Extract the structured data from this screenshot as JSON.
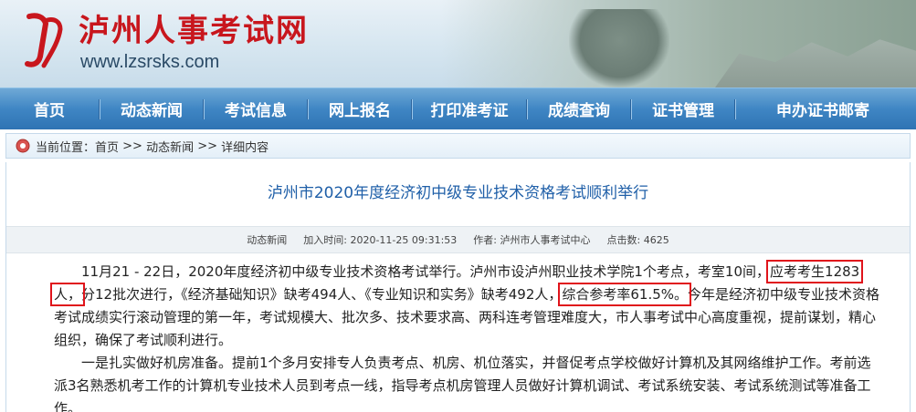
{
  "header": {
    "site_title": "泸州人事考试网",
    "site_url": "www.lzsrsks.com",
    "logo_icon": "lz-logo-icon",
    "brand_color": "#c8161d"
  },
  "nav": {
    "items": [
      {
        "label": "首页"
      },
      {
        "label": "动态新闻"
      },
      {
        "label": "考试信息"
      },
      {
        "label": "网上报名"
      },
      {
        "label": "打印准考证"
      },
      {
        "label": "成绩查询"
      },
      {
        "label": "证书管理"
      },
      {
        "label": "申办证书邮寄"
      }
    ]
  },
  "breadcrumb": {
    "prefix": "当前位置：",
    "home": "首页",
    "sep": " >> ",
    "section": "动态新闻",
    "current": "详细内容",
    "icon": "location-pin-icon"
  },
  "article": {
    "title": "泸州市2020年度经济初中级专业技术资格考试顺利举行",
    "meta": {
      "category": "动态新闻",
      "time_label": "加入时间:",
      "time_value": "2020-11-25 09:31:53",
      "author_label": "作者:",
      "author_value": "泸州市人事考试中心",
      "clicks_label": "点击数:",
      "clicks_value": "4625"
    },
    "p1_a": "11月21 - 22日，2020年度经济初中级专业技术资格考试举行。泸州市设泸州职业技术学院1个考点，考室10间，",
    "p1_hl1": "应考考生1283人，",
    "p1_b": "分12批次进行，《经济基础知识》缺考494人、《专业知识和实务》缺考492人，",
    "p1_hl2": "综合参考率61.5%。",
    "p1_c": "今年是经济初中级专业技术资格考试成绩实行滚动管理的第一年，考试规模大、批次多、技术要求高、两科连考管理难度大，市人事考试中心高度重视，提前谋划，精心组织，确保了考试顺利进行。",
    "p2": "一是扎实做好机房准备。提前1个多月安排专人负责考点、机房、机位落实，并督促考点学校做好计算机及其网络维护工作。考前选派3名熟悉机考工作的计算机专业技术人员到考点一线，指导考点机房管理人员做好计算机调试、考试系统安装、考试系统测试等准备工作。"
  },
  "colors": {
    "nav_blue": "#3f86c4",
    "title_blue": "#1f5fa8",
    "highlight_red": "#e0141b"
  }
}
